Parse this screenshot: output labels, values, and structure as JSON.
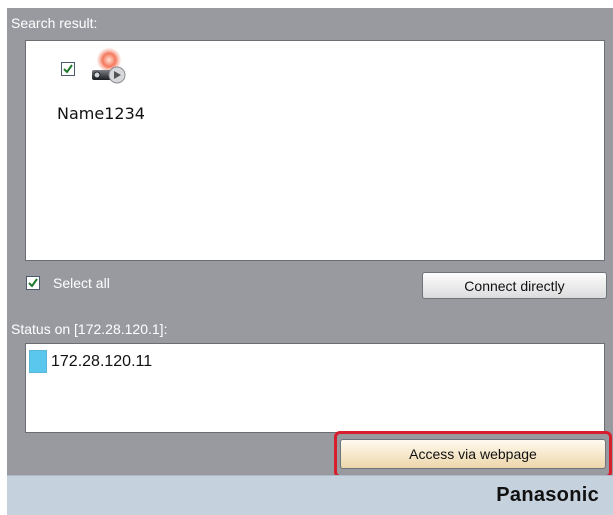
{
  "search": {
    "label": "Search result:",
    "devices": [
      {
        "name": "Name1234",
        "checked": true,
        "icon": "projector-icon"
      }
    ]
  },
  "select_all": {
    "label": "Select all",
    "checked": true
  },
  "connect_button": {
    "label": "Connect directly"
  },
  "status": {
    "label": "Status on [172.28.120.1]:",
    "items": [
      {
        "ip": "172.28.120.11",
        "color": "#5ac8ee"
      }
    ]
  },
  "access_button": {
    "label": "Access via webpage"
  },
  "brand": {
    "name": "Panasonic"
  },
  "colors": {
    "panel_bg": "#999aa0",
    "footer_bg": "#c6d1de",
    "highlight": "#d81e2c",
    "status_online": "#5ac8ee"
  }
}
